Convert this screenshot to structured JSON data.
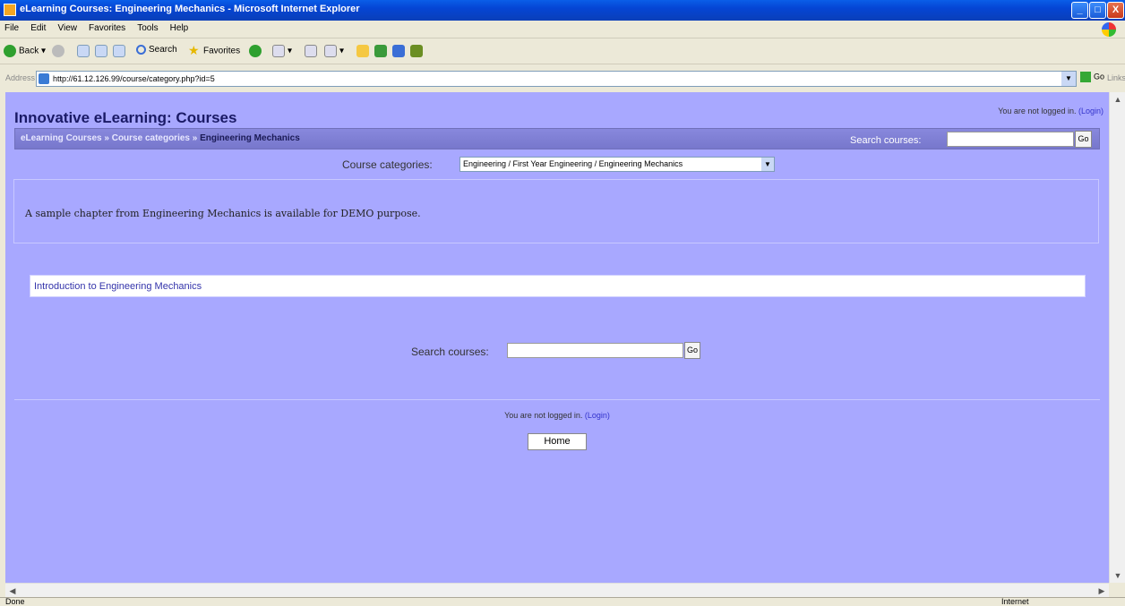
{
  "window": {
    "title": "eLearning Courses: Engineering Mechanics - Microsoft Internet Explorer",
    "buttons": [
      "_",
      "□",
      "X"
    ]
  },
  "menu": [
    "File",
    "Edit",
    "View",
    "Favorites",
    "Tools",
    "Help"
  ],
  "toolbar": {
    "back": "Back",
    "search": "Search",
    "favorites": "Favorites"
  },
  "address": {
    "label": "Address",
    "url": "http://61.12.126.99/course/category.php?id=5",
    "go": "Go",
    "links": "Links"
  },
  "page": {
    "title": "Innovative eLearning: Courses",
    "login_text": "You are not logged in.",
    "login_link": "(Login)",
    "breadcrumb": {
      "item1": "eLearning Courses",
      "item2": "Course categories",
      "current": "Engineering Mechanics",
      "sep": "»"
    },
    "search_label": "Search courses:",
    "go_label": "Go",
    "category_label": "Course categories:",
    "category_value": "Engineering / First Year Engineering / Engineering Mechanics",
    "summary": "A sample chapter from Engineering Mechanics is available for DEMO purpose.",
    "course_link": "Introduction to Engineering Mechanics",
    "home_button": "Home"
  },
  "status": {
    "left": "Done",
    "zone": "Internet"
  }
}
